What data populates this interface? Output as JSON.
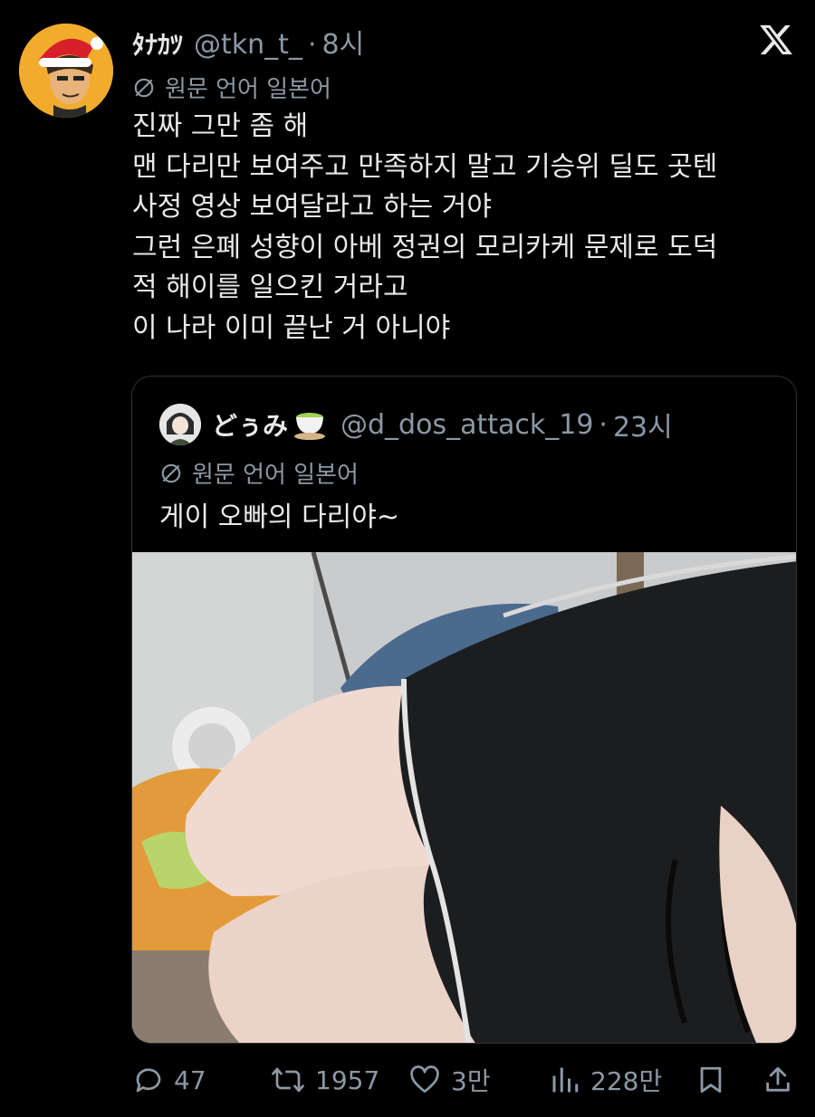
{
  "author": {
    "display_name": "ﾀﾅｶﾂ",
    "handle": "@tkn_t_",
    "separator": "·",
    "time": "8시"
  },
  "translation_label": "원문 언어 일본어",
  "tweet_lines": [
    "진짜 그만 좀 해",
    "맨 다리만 보여주고 만족하지 말고 기승위 딜도 곳텐",
    "사정 영상 보여달라고 하는 거야",
    "그런 은폐 성향이 아베 정권의 모리카케 문제로 도덕",
    "적 해이를 일으킨 거라고",
    "이 나라 이미 끝난 거 아니야"
  ],
  "quoted": {
    "display_name": "どぅみ",
    "handle": "@d_dos_attack_19",
    "separator": "·",
    "time": "23시",
    "translation_label": "원문 언어 일본어",
    "text": "게이 오빠의 다리야~"
  },
  "actions": {
    "replies": "47",
    "retweets": "1957",
    "likes": "3만",
    "views": "228만"
  },
  "icons": {
    "brand": "x-logo-icon",
    "translate": "translate-icon",
    "reply": "reply-icon",
    "retweet": "retweet-icon",
    "like": "heart-icon",
    "views": "views-icon",
    "bookmark": "bookmark-icon",
    "share": "share-icon"
  },
  "colors": {
    "background": "#000000",
    "text": "#e7e9ea",
    "muted": "#8b98a5",
    "border": "#2f3336",
    "avatar_bg": "#f2ac2c"
  }
}
